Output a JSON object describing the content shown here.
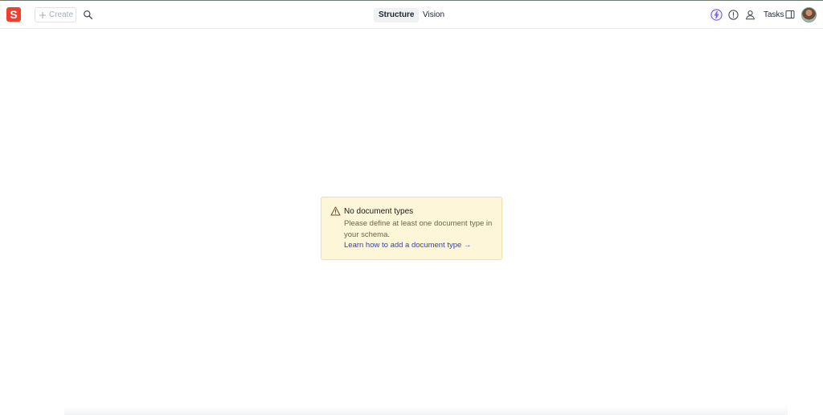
{
  "app": {
    "logo_letter": "S",
    "brand_color": "#f03e2f"
  },
  "toolbar": {
    "create_label": "Create",
    "search_icon": "search-icon"
  },
  "nav": {
    "tabs": [
      {
        "label": "Structure",
        "active": true
      },
      {
        "label": "Vision",
        "active": false
      }
    ]
  },
  "right_tools": {
    "icons": [
      "lightning-icon",
      "help-icon",
      "presence-icon"
    ],
    "tasks_label": "Tasks",
    "sidebar_icon": "panel-icon"
  },
  "alert": {
    "title": "No document types",
    "message": "Please define at least one document type in your schema.",
    "link": "Learn how to add a document type →",
    "background": "#fdf6d9",
    "link_color": "#2f42c9"
  }
}
